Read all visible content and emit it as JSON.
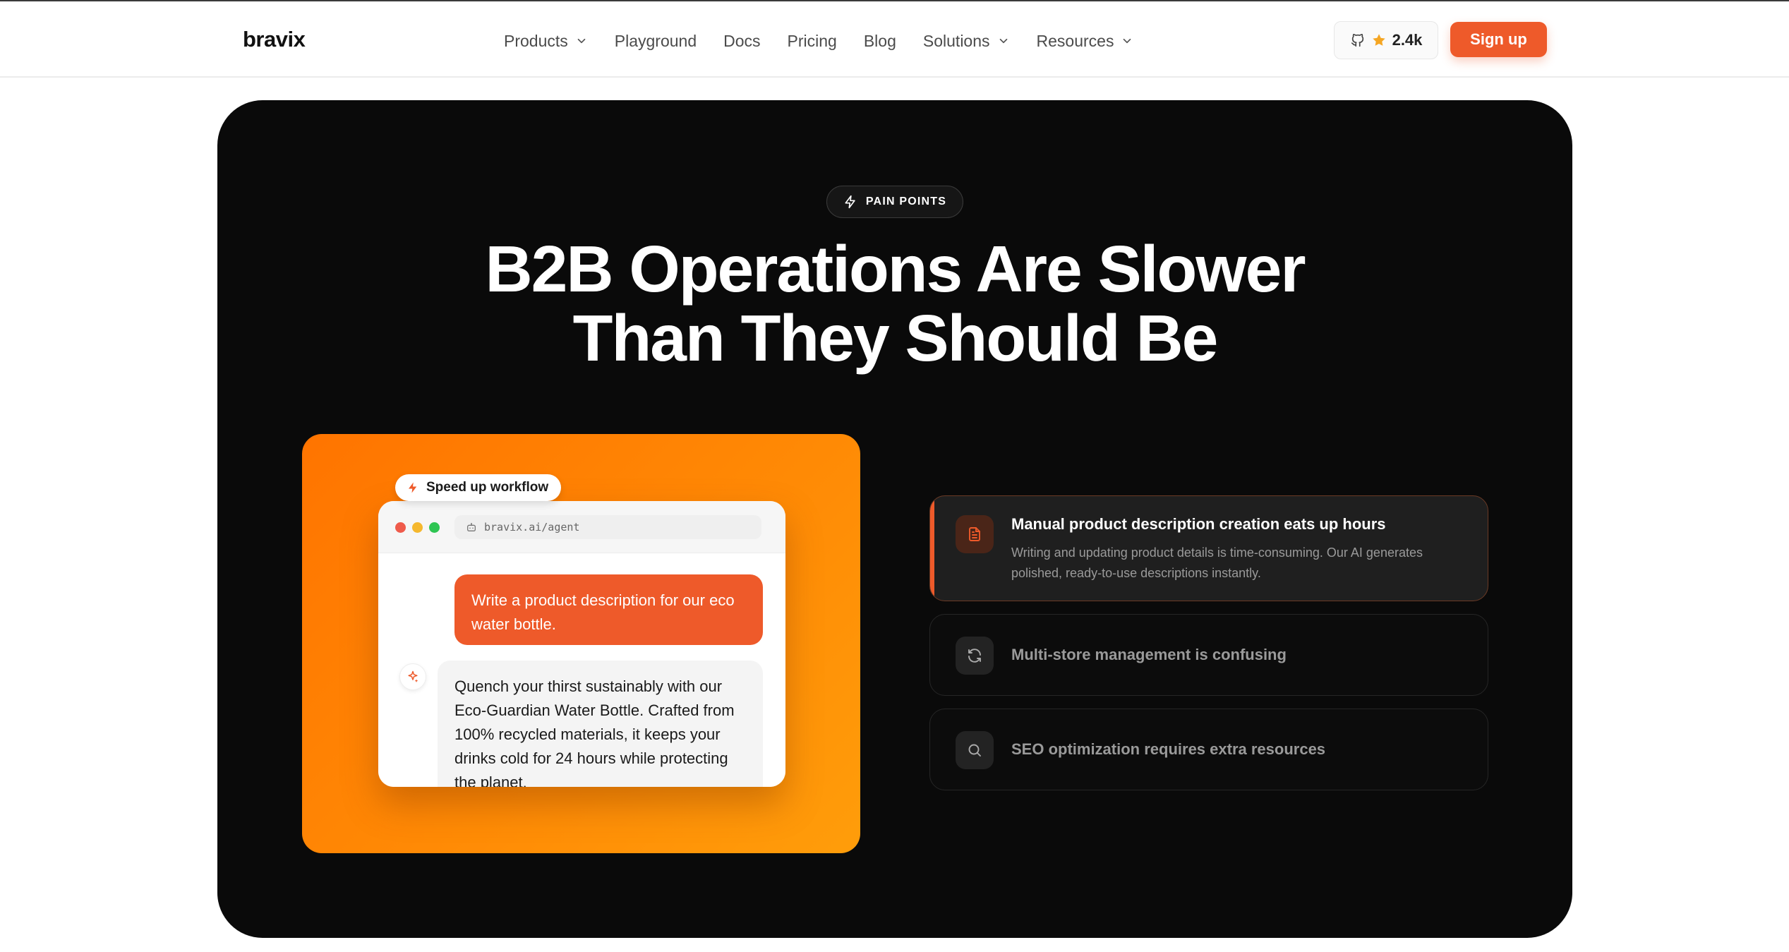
{
  "nav": {
    "logo": "bravix",
    "links": [
      {
        "label": "Products",
        "has_dropdown": true
      },
      {
        "label": "Playground",
        "has_dropdown": false
      },
      {
        "label": "Docs",
        "has_dropdown": false
      },
      {
        "label": "Pricing",
        "has_dropdown": false
      },
      {
        "label": "Blog",
        "has_dropdown": false
      },
      {
        "label": "Solutions",
        "has_dropdown": true
      },
      {
        "label": "Resources",
        "has_dropdown": true
      }
    ],
    "github_stars": "2.4k",
    "signup_label": "Sign up"
  },
  "hero": {
    "badge": "PAIN POINTS",
    "headline_line1": "B2B Operations Are Slower",
    "headline_line2": "Than They Should Be"
  },
  "demo": {
    "pill_label": "Speed up workflow",
    "url": "bravix.ai/agent",
    "user_message": "Write a product description for our eco water bottle.",
    "ai_message": "Quench your thirst sustainably with our Eco-Guardian Water Bottle. Crafted from 100% recycled materials, it keeps your drinks cold for 24 hours while protecting the planet."
  },
  "pain_points": [
    {
      "icon": "document-icon",
      "title": "Manual product description creation eats up hours",
      "description": "Writing and updating product details is time-consuming. Our AI generates polished, ready-to-use descriptions instantly.",
      "active": true
    },
    {
      "icon": "refresh-icon",
      "title": "Multi-store management is confusing",
      "active": false
    },
    {
      "icon": "search-icon",
      "title": "SEO optimization requires extra resources",
      "active": false
    }
  ],
  "colors": {
    "accent": "#ee5a2a",
    "hero_bg": "#0a0a0a",
    "panel_gradient_start": "#ff7400",
    "panel_gradient_end": "#ff9d0a",
    "star": "#f5a623"
  }
}
